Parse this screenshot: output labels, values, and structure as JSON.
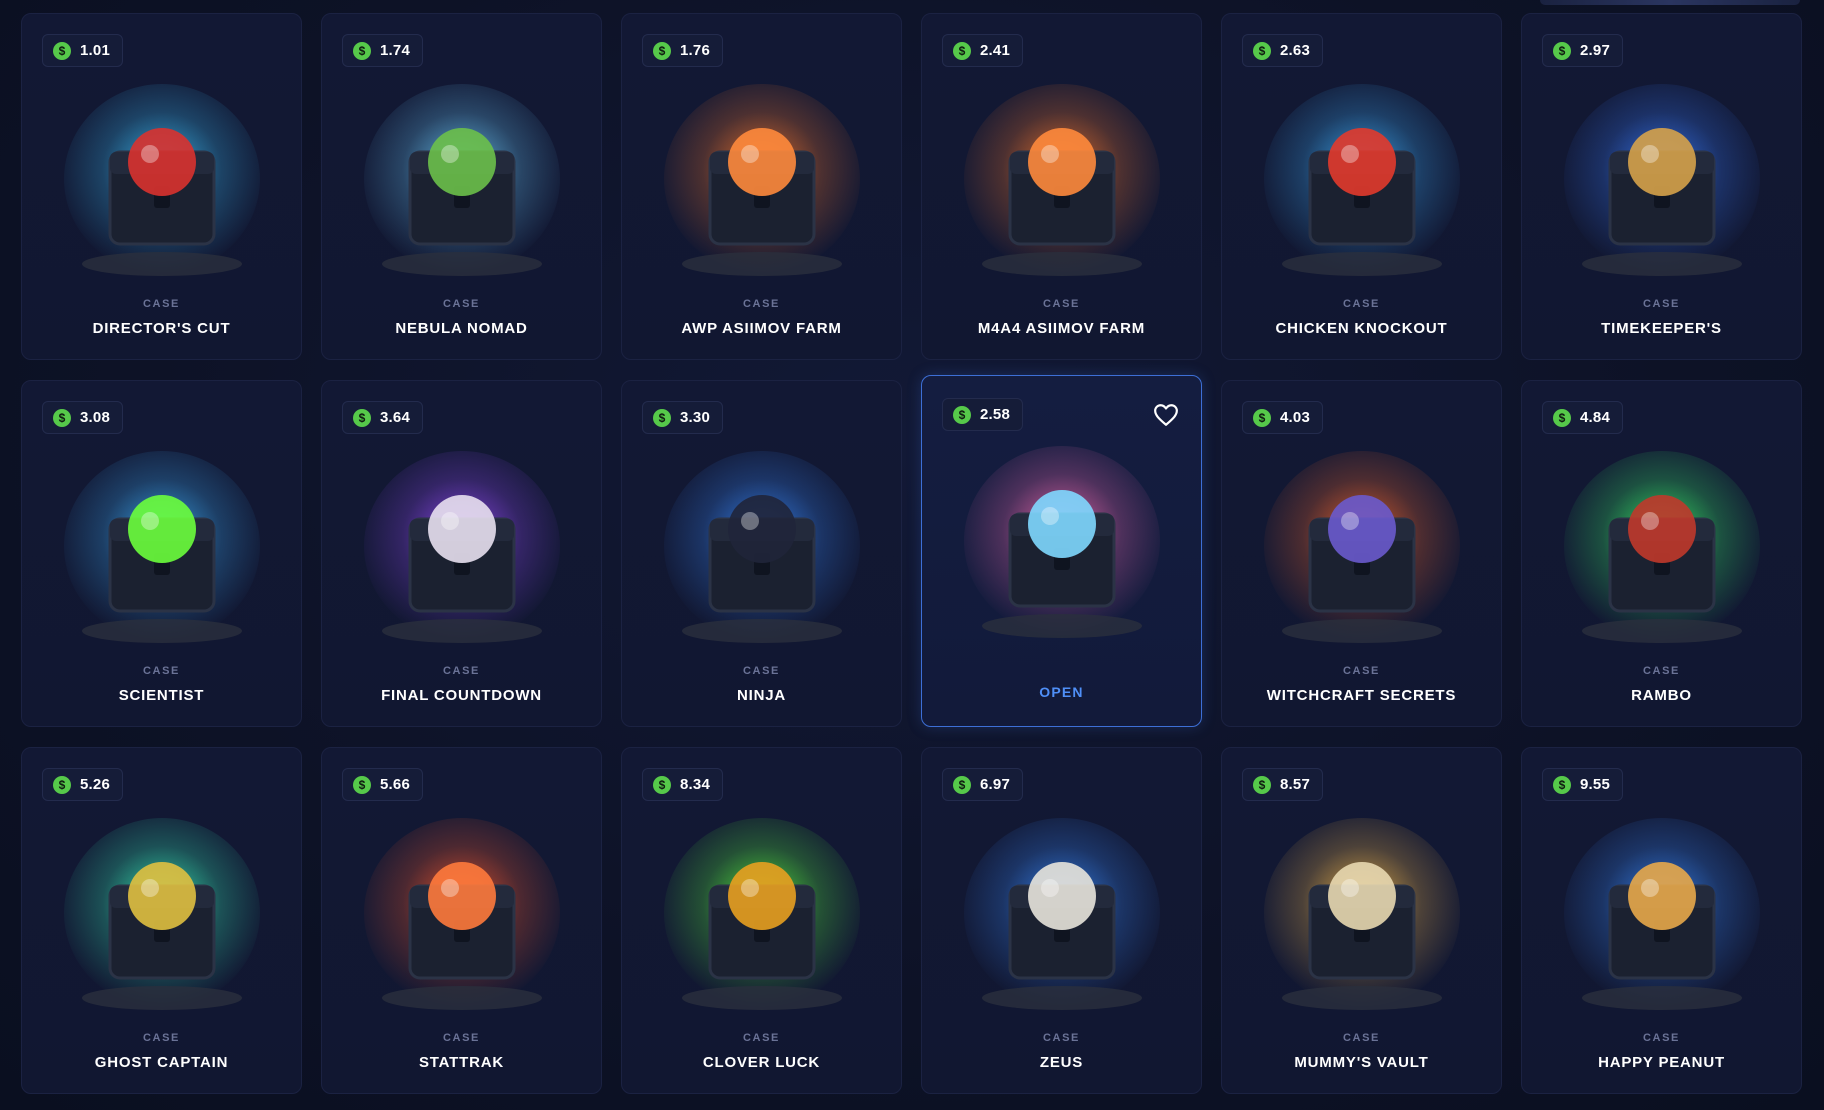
{
  "case_label": "CASE",
  "open_label": "OPEN",
  "cases": [
    {
      "price": "1.01",
      "name": "DIRECTOR'S CUT",
      "icon": "film-projector-popcorn-icon",
      "glow": "#3ec7ff",
      "accent": "#d9322f"
    },
    {
      "price": "1.74",
      "name": "NEBULA NOMAD",
      "icon": "alien-ufo-icon",
      "glow": "#6fd0ff",
      "accent": "#6cc04a"
    },
    {
      "price": "1.76",
      "name": "AWP ASIIMOV FARM",
      "icon": "sniper-rifle-crate-icon",
      "glow": "#ff7a2a",
      "accent": "#ff8a3c"
    },
    {
      "price": "2.41",
      "name": "M4A4 ASIIMOV FARM",
      "icon": "assault-rifle-crate-icon",
      "glow": "#ff7a2a",
      "accent": "#ff8a3c"
    },
    {
      "price": "2.63",
      "name": "CHICKEN KNOCKOUT",
      "icon": "boxing-rooster-icon",
      "glow": "#3fb4ff",
      "accent": "#e23a2c"
    },
    {
      "price": "2.97",
      "name": "TIMEKEEPER'S",
      "icon": "hourglass-icon",
      "glow": "#3a7dff",
      "accent": "#d6a24a"
    },
    {
      "price": "3.08",
      "name": "SCIENTIST",
      "icon": "scientist-beaker-icon",
      "glow": "#3fb4ff",
      "accent": "#6cff3c"
    },
    {
      "price": "3.64",
      "name": "FINAL COUNTDOWN",
      "icon": "bomb-device-icon",
      "glow": "#9b4dff",
      "accent": "#e8e0f0"
    },
    {
      "price": "3.30",
      "name": "NINJA",
      "icon": "ninja-rifle-icon",
      "glow": "#3a8cff",
      "accent": "#20253a"
    },
    {
      "price": "2.58",
      "name": "",
      "icon": "ice-cream-cones-icon",
      "glow": "#ff6fb6",
      "accent": "#7fd8ff",
      "active": true
    },
    {
      "price": "4.03",
      "name": "WITCHCRAFT SECRETS",
      "icon": "witch-crystal-ball-icon",
      "glow": "#ff6a2a",
      "accent": "#6a5acd"
    },
    {
      "price": "4.84",
      "name": "RAMBO",
      "icon": "commando-rifle-icon",
      "glow": "#3cff6a",
      "accent": "#c0392b"
    },
    {
      "price": "5.26",
      "name": "GHOST CAPTAIN",
      "icon": "pirate-skeleton-icon",
      "glow": "#3cffc0",
      "accent": "#e0c040"
    },
    {
      "price": "5.66",
      "name": "STATTRAK",
      "icon": "stattrak-rifle-crate-icon",
      "glow": "#ff5a2a",
      "accent": "#ff7a3c"
    },
    {
      "price": "8.34",
      "name": "CLOVER LUCK",
      "icon": "leprechaun-pot-icon",
      "glow": "#5cff3c",
      "accent": "#e8a020"
    },
    {
      "price": "6.97",
      "name": "ZEUS",
      "icon": "zeus-lightning-icon",
      "glow": "#3a8cff",
      "accent": "#e8e4dc"
    },
    {
      "price": "8.57",
      "name": "MUMMY'S VAULT",
      "icon": "mummy-lantern-icon",
      "glow": "#ffc04a",
      "accent": "#e8d8b0"
    },
    {
      "price": "9.55",
      "name": "HAPPY PEANUT",
      "icon": "peanut-character-icon",
      "glow": "#3a8cff",
      "accent": "#e8a84a"
    }
  ]
}
